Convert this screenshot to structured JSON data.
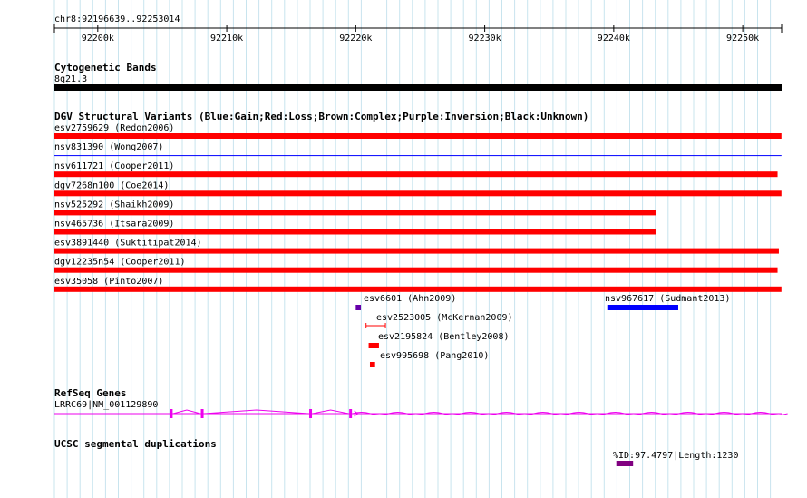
{
  "region": "chr8:92196639..92253014",
  "ruler_ticks": [
    "92200k",
    "92210k",
    "92220k",
    "92230k",
    "92240k",
    "92250k"
  ],
  "tracks": {
    "cytoband": {
      "title": "Cytogenetic Bands",
      "band": "8q21.3",
      "color": "#000000"
    },
    "dgv": {
      "title": "DGV Structural Variants (Blue:Gain;Red:Loss;Brown:Complex;Purple:Inversion;Black:Unknown)",
      "colors": {
        "loss": "#ff0000",
        "gain": "#0000ff",
        "inversion": "#6600aa"
      },
      "full_rows": [
        {
          "label": "esv2759629 (Redon2006)",
          "type": "loss",
          "end_k": 92253.0
        },
        {
          "label": "nsv831390 (Wong2007)",
          "type": "gain",
          "end_k": 92253.0
        },
        {
          "label": "nsv611721 (Cooper2011)",
          "type": "loss",
          "end_k": 92252.7
        },
        {
          "label": "dgv7268n100 (Coe2014)",
          "type": "loss",
          "end_k": 92253.0
        },
        {
          "label": "nsv525292 (Shaikh2009)",
          "type": "loss",
          "end_k": 92243.3
        },
        {
          "label": "nsv465736 (Itsara2009)",
          "type": "loss",
          "end_k": 92243.3
        },
        {
          "label": "esv3891440 (Suktitipat2014)",
          "type": "loss",
          "end_k": 92252.8
        },
        {
          "label": "dgv12235n54 (Cooper2011)",
          "type": "loss",
          "end_k": 92252.7
        },
        {
          "label": "esv35058 (Pinto2007)",
          "type": "loss",
          "end_k": 92253.0
        }
      ],
      "small": [
        {
          "label": "esv6601 (Ahn2009)",
          "type": "inversion",
          "start_k": 92220.0,
          "end_k": 92220.4
        },
        {
          "label": "nsv967617 (Sudmant2013)",
          "type": "gain",
          "start_k": 92239.5,
          "end_k": 92245.0
        },
        {
          "label": "esv2523005 (McKernan2009)",
          "type": "loss",
          "start_k": 92220.8,
          "end_k": 92222.3
        },
        {
          "label": "esv2195824 (Bentley2008)",
          "type": "loss",
          "start_k": 92221.0,
          "end_k": 92221.8
        },
        {
          "label": "esv995698 (Pang2010)",
          "type": "loss",
          "start_k": 92221.1,
          "end_k": 92221.5
        }
      ]
    },
    "refseq": {
      "title": "RefSeq Genes",
      "gene": "LRRC69|NM_001129890",
      "color": "#ee00ee",
      "exons_k": [
        92205.7,
        92208.1,
        92216.5,
        92219.6
      ]
    },
    "segdup": {
      "title": "UCSC segmental duplications",
      "feature": "%ID:97.4797|Length:1230",
      "color": "#800080",
      "start_k": 92240.2,
      "end_k": 92241.5
    }
  }
}
